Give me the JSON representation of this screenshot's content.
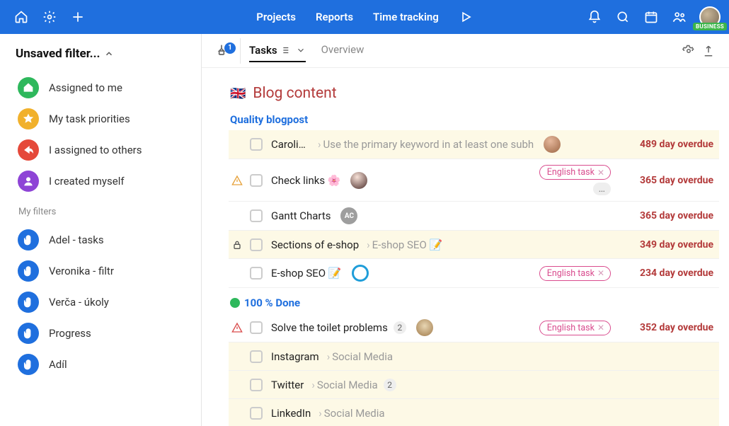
{
  "topnav": {
    "items": [
      "Projects",
      "Reports",
      "Time tracking"
    ]
  },
  "avatar_badge": "BUSINESS",
  "sidebar": {
    "title": "Unsaved filter...",
    "preset": [
      {
        "label": "Assigned to me",
        "color": "#2eb85c",
        "icon": "home"
      },
      {
        "label": "My task priorities",
        "color": "#f1b12c",
        "icon": "star"
      },
      {
        "label": "I assigned to others",
        "color": "#e5493a",
        "icon": "share"
      },
      {
        "label": "I created myself",
        "color": "#8e44d6",
        "icon": "user"
      }
    ],
    "filters_label": "My filters",
    "filters": [
      {
        "label": "Adel - tasks"
      },
      {
        "label": "Veronika - filtr"
      },
      {
        "label": "Verča - úkoly"
      },
      {
        "label": "Progress"
      },
      {
        "label": "Adíl"
      }
    ]
  },
  "pin_count": "1",
  "tabs": {
    "active": "Tasks",
    "inactive": "Overview"
  },
  "page": {
    "flag": "🇬🇧",
    "title": "Blog content"
  },
  "groups": [
    {
      "title": "Quality blogpost",
      "dot": null,
      "tasks": [
        {
          "hl": true,
          "pre": null,
          "name": "Carolina",
          "trunc": true,
          "crumb": "Use the primary keyword in at least one subh",
          "assignee": "photo1",
          "assignee_text": "",
          "tag": null,
          "more": false,
          "count": null,
          "overdue": "489 day overdue"
        },
        {
          "hl": false,
          "pre": "warn",
          "name": "Check links 🌸",
          "crumb": null,
          "assignee": "photo2",
          "assignee_text": "",
          "tag": "English task",
          "more": true,
          "count": null,
          "overdue": "365 day overdue"
        },
        {
          "hl": false,
          "pre": null,
          "name": "Gantt Charts",
          "crumb": null,
          "assignee": "ac",
          "assignee_text": "AC",
          "tag": null,
          "more": false,
          "count": null,
          "overdue": "365 day overdue"
        },
        {
          "hl": true,
          "pre": "lock",
          "name": "Sections of e-shop",
          "crumb": "E-shop SEO 📝",
          "assignee": null,
          "tag": null,
          "more": false,
          "count": null,
          "overdue": "349 day overdue"
        },
        {
          "hl": false,
          "pre": null,
          "name": "E-shop SEO 📝",
          "crumb": null,
          "assignee": "ring",
          "assignee_text": "",
          "tag": "English task",
          "more": false,
          "count": null,
          "overdue": "234 day overdue"
        }
      ]
    },
    {
      "title": "100 % Done",
      "dot": "#2eb85c",
      "tasks": [
        {
          "hl": false,
          "pre": "alert",
          "name": "Solve the toilet problems",
          "crumb": null,
          "assignee": "dog",
          "assignee_text": "",
          "tag": "English task",
          "more": false,
          "count": "2",
          "overdue": "352 day overdue"
        },
        {
          "hl": true,
          "pre": null,
          "name": "Instagram",
          "crumb": "Social Media",
          "assignee": null,
          "tag": null,
          "more": false,
          "count": null,
          "overdue": ""
        },
        {
          "hl": true,
          "pre": null,
          "name": "Twitter",
          "crumb": "Social Media",
          "assignee": null,
          "tag": null,
          "more": false,
          "count": "2",
          "overdue": ""
        },
        {
          "hl": true,
          "pre": null,
          "name": "LinkedIn",
          "crumb": "Social Media",
          "assignee": null,
          "tag": null,
          "more": false,
          "count": null,
          "overdue": ""
        }
      ]
    }
  ]
}
